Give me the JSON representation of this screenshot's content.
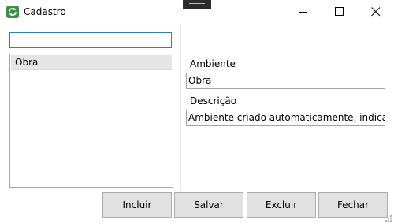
{
  "window": {
    "title": "Cadastro",
    "app_icon": "refresh-app-icon",
    "controls": [
      "minimize-icon",
      "maximize-icon",
      "close-icon"
    ]
  },
  "search": {
    "value": ""
  },
  "list": {
    "items": [
      {
        "label": "Obra",
        "selected": true
      }
    ]
  },
  "form": {
    "ambiente_label": "Ambiente",
    "ambiente_value": "Obra",
    "descricao_label": "Descrição",
    "descricao_value": "Ambiente criado automaticamente, indica qualquer"
  },
  "buttons": {
    "incluir": "Incluir",
    "salvar": "Salvar",
    "excluir": "Excluir",
    "fechar": "Fechar"
  },
  "colors": {
    "accent_focus": "#2f7ad0",
    "app_icon_green": "#3c8f47",
    "button_face": "#e1e1e1",
    "selected_item": "#e6e6e6"
  }
}
